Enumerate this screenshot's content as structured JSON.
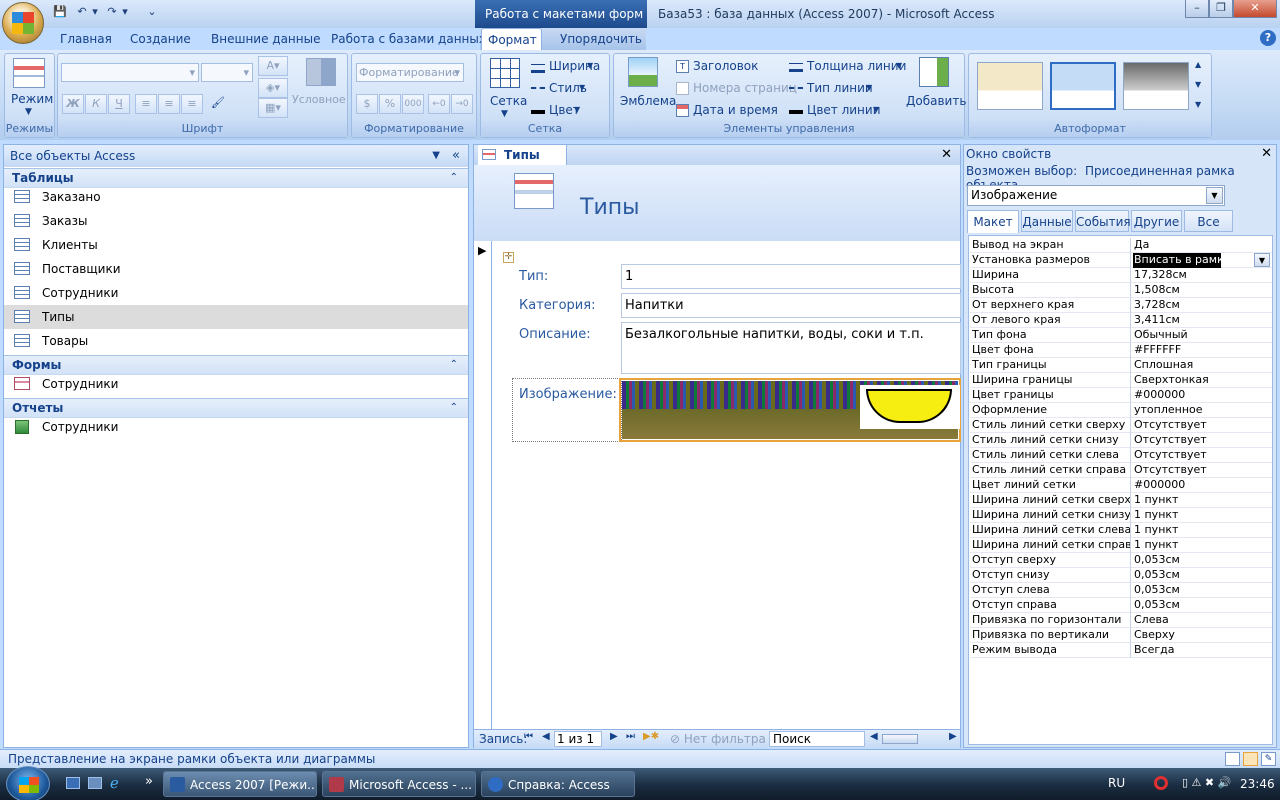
{
  "window": {
    "contextual_tab_title": "Работа с макетами форм",
    "app_title": "База53 : база данных (Access 2007) - Microsoft Access",
    "controls": [
      "–",
      "❐",
      "✕"
    ]
  },
  "ribbon": {
    "tabs": [
      "Главная",
      "Создание",
      "Внешние данные",
      "Работа с базами данных",
      "Формат",
      "Упорядочить"
    ],
    "active_tab": "Формат",
    "groups": {
      "modes": {
        "caption": "Режимы",
        "mode_button": "Режим"
      },
      "font": {
        "caption": "Шрифт",
        "bold": "Ж",
        "italic": "К",
        "underline": "Ч",
        "conditional": "Условное"
      },
      "formatting": {
        "caption": "Форматирование",
        "format_combo": "Форматирование",
        "percent": "%",
        "thousands": "000"
      },
      "grid": {
        "caption": "Сетка",
        "grid_button": "Сетка",
        "width": "Ширина",
        "style": "Стиль",
        "color": "Цвет"
      },
      "controls": {
        "caption": "Элементы управления",
        "logo": "Эмблема",
        "title": "Заголовок",
        "page_numbers": "Номера страниц",
        "date_time": "Дата и время",
        "line_thickness": "Толщина линии",
        "line_type": "Тип линии",
        "line_color": "Цвет линии",
        "add_fields": "Добавить поля"
      },
      "autoformat": {
        "caption": "Автоформат"
      }
    }
  },
  "nav_pane": {
    "title": "Все объекты Access",
    "groups": [
      {
        "label": "Таблицы",
        "items": [
          "Заказано",
          "Заказы",
          "Клиенты",
          "Поставщики",
          "Сотрудники",
          "Типы",
          "Товары"
        ]
      },
      {
        "label": "Формы",
        "items": [
          "Сотрудники"
        ]
      },
      {
        "label": "Отчеты",
        "items": [
          "Сотрудники"
        ]
      }
    ],
    "selected_item": "Типы"
  },
  "document": {
    "tab_label": "Типы",
    "form_title": "Типы",
    "fields": [
      {
        "label": "Тип:",
        "value": "1"
      },
      {
        "label": "Категория:",
        "value": "Напитки"
      },
      {
        "label": "Описание:",
        "value": "Безалкогольные напитки, воды, соки и т.п."
      },
      {
        "label": "Изображение:",
        "value": ""
      }
    ],
    "record_nav": {
      "label": "Запись:",
      "position": "1 из 1",
      "filter": "Нет фильтра",
      "search": "Поиск"
    }
  },
  "property_sheet": {
    "title": "Окно свойств",
    "selection_type_label": "Возможен выбор:",
    "selection_type_value": "Присоединенная рамка объекта",
    "selected_object": "Изображение",
    "tabs": [
      "Макет",
      "Данные",
      "События",
      "Другие",
      "Все"
    ],
    "active_tab": "Макет",
    "rows": [
      {
        "k": "Вывод на экран",
        "v": "Да"
      },
      {
        "k": "Установка размеров",
        "v": "Вписать в рамку"
      },
      {
        "k": "Ширина",
        "v": "17,328см"
      },
      {
        "k": "Высота",
        "v": "1,508см"
      },
      {
        "k": "От верхнего края",
        "v": "3,728см"
      },
      {
        "k": "От левого края",
        "v": "3,411см"
      },
      {
        "k": "Тип фона",
        "v": "Обычный"
      },
      {
        "k": "Цвет фона",
        "v": "#FFFFFF"
      },
      {
        "k": "Тип границы",
        "v": "Сплошная"
      },
      {
        "k": "Ширина границы",
        "v": "Сверхтонкая"
      },
      {
        "k": "Цвет границы",
        "v": "#000000"
      },
      {
        "k": "Оформление",
        "v": "утопленное"
      },
      {
        "k": "Стиль линий сетки сверху",
        "v": "Отсутствует"
      },
      {
        "k": "Стиль линий сетки снизу",
        "v": "Отсутствует"
      },
      {
        "k": "Стиль линий сетки слева",
        "v": "Отсутствует"
      },
      {
        "k": "Стиль линий сетки справа",
        "v": "Отсутствует"
      },
      {
        "k": "Цвет линий сетки",
        "v": "#000000"
      },
      {
        "k": "Ширина линий сетки сверху",
        "v": "1 пункт"
      },
      {
        "k": "Ширина линий сетки снизу",
        "v": "1 пункт"
      },
      {
        "k": "Ширина линий сетки слева",
        "v": "1 пункт"
      },
      {
        "k": "Ширина линий сетки справа",
        "v": "1 пункт"
      },
      {
        "k": "Отступ сверху",
        "v": "0,053см"
      },
      {
        "k": "Отступ снизу",
        "v": "0,053см"
      },
      {
        "k": "Отступ слева",
        "v": "0,053см"
      },
      {
        "k": "Отступ справа",
        "v": "0,053см"
      },
      {
        "k": "Привязка по горизонтали",
        "v": "Слева"
      },
      {
        "k": "Привязка по вертикали",
        "v": "Сверху"
      },
      {
        "k": "Режим вывода",
        "v": "Всегда"
      }
    ],
    "selected_row": 1
  },
  "status_bar": {
    "text": "Представление на экране рамки объекта или диаграммы"
  },
  "taskbar": {
    "buttons": [
      "Access 2007 [Режи...",
      "Microsoft Access - ...",
      "Справка: Access"
    ],
    "language": "RU",
    "time": "23:46",
    "more": "»"
  }
}
